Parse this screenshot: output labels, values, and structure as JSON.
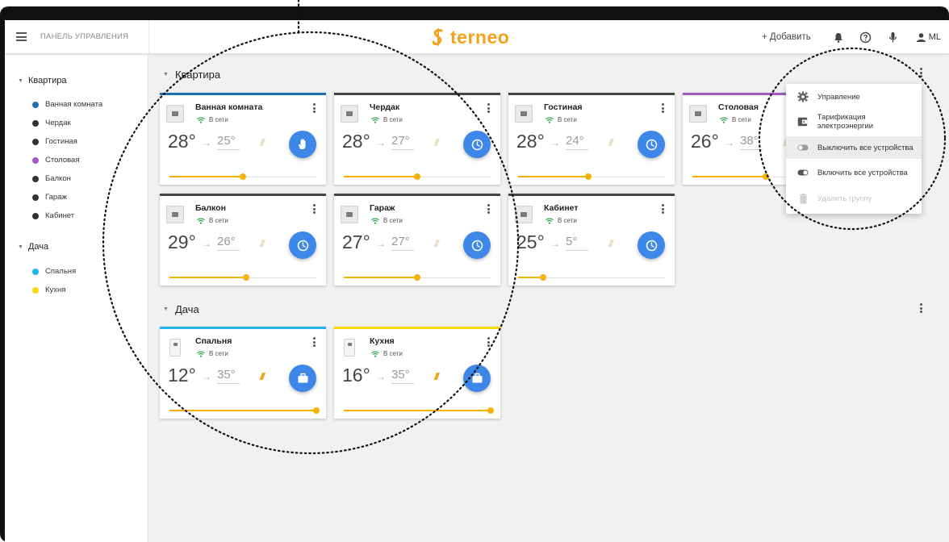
{
  "header": {
    "panel_title": "ПАНЕЛЬ УПРАВЛЕНИЯ",
    "logo_text": "terneo",
    "add_label": "+ Добавить",
    "user_initials": "ML"
  },
  "sidebar": {
    "groups": [
      {
        "title": "Квартира",
        "items": [
          {
            "label": "Ванная комната",
            "color": "#1f6fb5"
          },
          {
            "label": "Чердак",
            "color": "#333333"
          },
          {
            "label": "Гостиная",
            "color": "#333333"
          },
          {
            "label": "Столовая",
            "color": "#a25bbd"
          },
          {
            "label": "Балкон",
            "color": "#333333"
          },
          {
            "label": "Гараж",
            "color": "#333333"
          },
          {
            "label": "Кабинет",
            "color": "#333333"
          }
        ]
      },
      {
        "title": "Дача",
        "items": [
          {
            "label": "Спальня",
            "color": "#21b5ea"
          },
          {
            "label": "Кухня",
            "color": "#f5d90a"
          }
        ]
      }
    ]
  },
  "sections": [
    {
      "title": "Квартира"
    },
    {
      "title": "Дача"
    }
  ],
  "cards": [
    {
      "name": "Ванная комната",
      "status": "В сети",
      "current": "28°",
      "arrow": "→",
      "target": "25°",
      "heat": "///",
      "heating": false,
      "mode": "hand-icon",
      "level": 0.5,
      "accent": "#1f6fb5",
      "device": "flat"
    },
    {
      "name": "Чердак",
      "status": "В сети",
      "current": "28°",
      "arrow": "→",
      "target": "27°",
      "heat": "///",
      "heating": false,
      "mode": "clock-icon",
      "level": 0.5,
      "accent": "#444444",
      "device": "flat"
    },
    {
      "name": "Гостиная",
      "status": "В сети",
      "current": "28°",
      "arrow": "→",
      "target": "24°",
      "heat": "///",
      "heating": false,
      "mode": "clock-icon",
      "level": 0.48,
      "accent": "#444444",
      "device": "flat"
    },
    {
      "name": "Столовая",
      "status": "В сети",
      "current": "26°",
      "arrow": "→",
      "target": "38°",
      "heat": "///",
      "heating": false,
      "mode": "clock-icon",
      "level": 0.5,
      "accent": "#a25bbd",
      "device": "flat"
    },
    {
      "name": "Балкон",
      "status": "В сети",
      "current": "29°",
      "arrow": "→",
      "target": "26°",
      "heat": "///",
      "heating": false,
      "mode": "clock-icon",
      "level": 0.52,
      "accent": "#444444",
      "device": "flat"
    },
    {
      "name": "Гараж",
      "status": "В сети",
      "current": "27°",
      "arrow": "→",
      "target": "27°",
      "heat": "///",
      "heating": false,
      "mode": "clock-icon",
      "level": 0.5,
      "accent": "#444444",
      "device": "flat"
    },
    {
      "name": "Кабинет",
      "status": "В сети",
      "current": "25°",
      "arrow": "→",
      "target": "5°",
      "heat": "///",
      "heating": false,
      "mode": "clock-icon",
      "level": 0.17,
      "accent": "#444444",
      "device": "flat"
    },
    {
      "name": "Спальня",
      "status": "В сети",
      "current": "12°",
      "arrow": "→",
      "target": "35°",
      "heat": "///",
      "heating": true,
      "mode": "briefcase-icon",
      "level": 1.0,
      "accent": "#21b5ea",
      "device": "tall"
    },
    {
      "name": "Кухня",
      "status": "В сети",
      "current": "16°",
      "arrow": "→",
      "target": "35°",
      "heat": "///",
      "heating": true,
      "mode": "briefcase-icon",
      "level": 1.0,
      "accent": "#f5d90a",
      "device": "tall"
    }
  ],
  "dropdown": {
    "items": [
      {
        "label": "Управление",
        "icon": "gear-icon",
        "highlighted": false,
        "disabled": false
      },
      {
        "label": "Тарификация электроэнергии",
        "icon": "wallet-icon",
        "highlighted": false,
        "disabled": false
      },
      {
        "label": "Выключить все устройства",
        "icon": "toggle-off-icon",
        "highlighted": true,
        "disabled": false
      },
      {
        "label": "Включить все устройства",
        "icon": "toggle-on-icon",
        "highlighted": false,
        "disabled": false
      },
      {
        "label": "Удалить группу",
        "icon": "trash-icon",
        "highlighted": false,
        "disabled": true
      }
    ]
  }
}
